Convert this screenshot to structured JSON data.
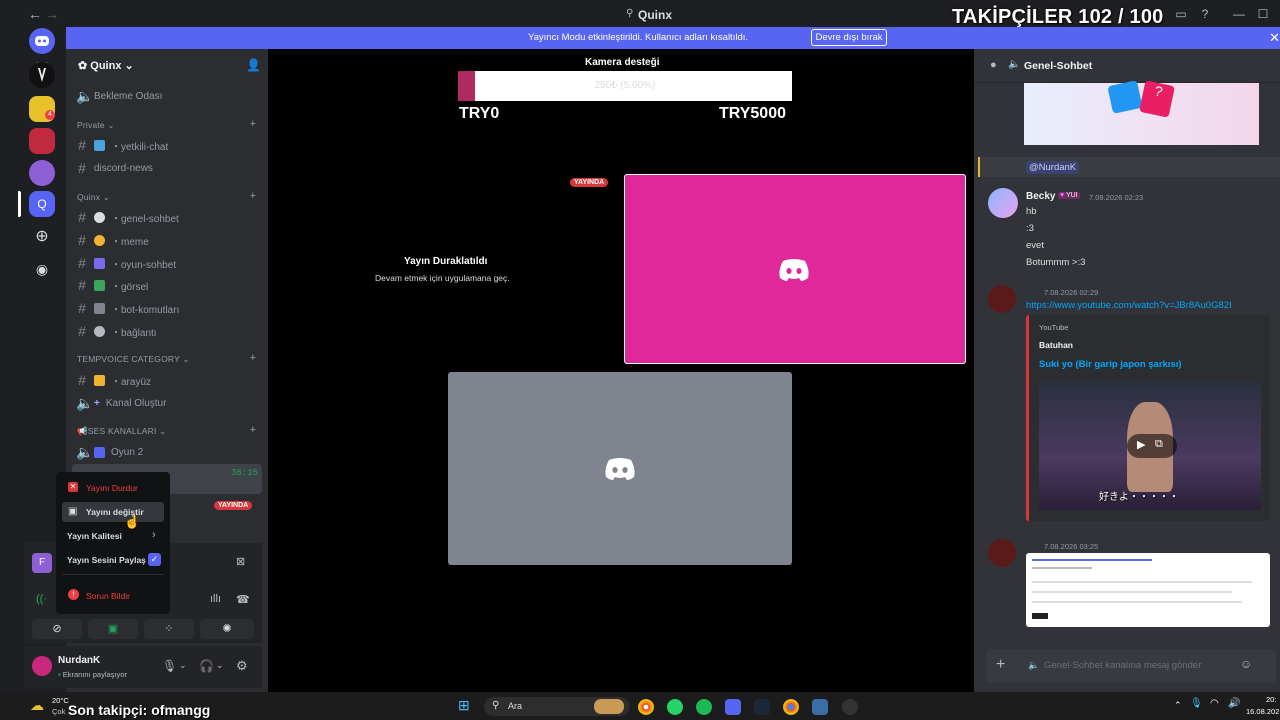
{
  "titlebar": {
    "title": "Quinx",
    "back": "←",
    "forward": "→"
  },
  "overlay": {
    "followers": "TAKİPÇİLER 102 / 100",
    "last_follower": "Son takipçi: ofmangg"
  },
  "banner": {
    "message": "Yayıncı Modu etkinleştirildi. Kullanıcı adları kısaltıldı.",
    "button": "Devre dışı bırak"
  },
  "server": {
    "name": "Quinx",
    "afk_channel": "Bekleme Odası",
    "categories": [
      {
        "name": "Private",
        "channels": [
          "・yetkili-chat",
          "discord-news"
        ]
      },
      {
        "name": "Quinx",
        "channels": [
          "・genel-sohbet",
          "・meme",
          "・oyun-sohbet",
          "・görsel",
          "・bot-komutları",
          "・bağlantı"
        ]
      },
      {
        "name": "TEMPVOICE CATEGORY",
        "channels": [
          "・arayüz",
          "Kanal Oluştur"
        ]
      },
      {
        "name": "📢SES KANALLARI",
        "channels": [
          "Oyun 2"
        ]
      }
    ],
    "voice_timer": "36:15",
    "live_badge": "YAYINDA"
  },
  "stream_menu": {
    "stop": "Yayını Durdur",
    "change": "Yayını değiştir",
    "quality": "Yayın Kalitesi",
    "share_audio": "Yayın Sesini Paylaş",
    "report": "Sorun Bildir"
  },
  "user": {
    "name": "NurdanK",
    "status": "Ekranını paylaşıyor"
  },
  "stage": {
    "donation_title": "Kamera desteği",
    "donation_progress_text": "250₺ (5.00%)",
    "donation_progress": 0.05,
    "donation_min": "TRY0",
    "donation_max": "TRY5000",
    "live_badge": "YAYINDA",
    "paused_title": "Yayın Duraklatıldı",
    "paused_sub": "Devam etmek için uygulamana geç."
  },
  "chat": {
    "channel": "Genel-Sohbet",
    "mention": "@NurdanK",
    "messages": [
      {
        "author": "Becky",
        "tag": "YUI",
        "time": "7.08.2026 02:23",
        "lines": [
          "hb",
          ":3",
          "evet",
          "Botummm >:3"
        ]
      },
      {
        "time": "7.08.2026 02:29",
        "link": "https://www.youtube.com/watch?v=JBr8Au0G82I",
        "embed_provider": "YouTube",
        "embed_author": "Batuhan",
        "embed_title": "Suki yo (Bir garip japon şarkısı)",
        "video_caption": "好きよ・・・・・"
      },
      {
        "time": "7.08.2026 03:25"
      }
    ],
    "input_placeholder": "Genel-Sohbet kanalına mesaj gönder"
  },
  "taskbar": {
    "weather_temp": "20°C",
    "weather_desc": "Çok",
    "search": "Ara",
    "clock_time": "20:",
    "clock_date": "16.08.202"
  },
  "colors": {
    "blurple": "#5865f2",
    "live_red": "#da373c",
    "stream_pink": "#e0289a",
    "link": "#00a8fc"
  }
}
